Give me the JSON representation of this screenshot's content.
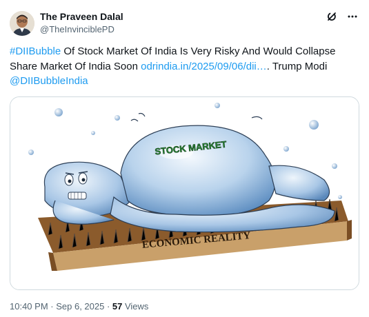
{
  "author": {
    "display_name": "The Praveen Dalal",
    "handle": "@TheInvinciblePD"
  },
  "icons": {
    "grok": "grok-icon",
    "more": "more-options-icon"
  },
  "tweet": {
    "hashtag": "#DIIBubble",
    "text_part1": " Of Stock Market Of India Is Very Risky And Would Collapse Share Market Of India Soon ",
    "link": "odrindia.in/2025/09/06/dii…",
    "text_part2": ". Trump Modi",
    "mention": "@DIIBubbleIndia"
  },
  "image": {
    "balloon_label": "STOCK MARKET",
    "board_label": "ECONOMIC REALITY"
  },
  "meta": {
    "time": "10:40 PM",
    "sep1": " · ",
    "date": "Sep 6, 2025",
    "sep2": " · ",
    "views_count": "57",
    "views_label": " Views"
  },
  "colors": {
    "link": "#1d9bf0",
    "secondary_text": "#536471",
    "border": "#cfd9de"
  }
}
